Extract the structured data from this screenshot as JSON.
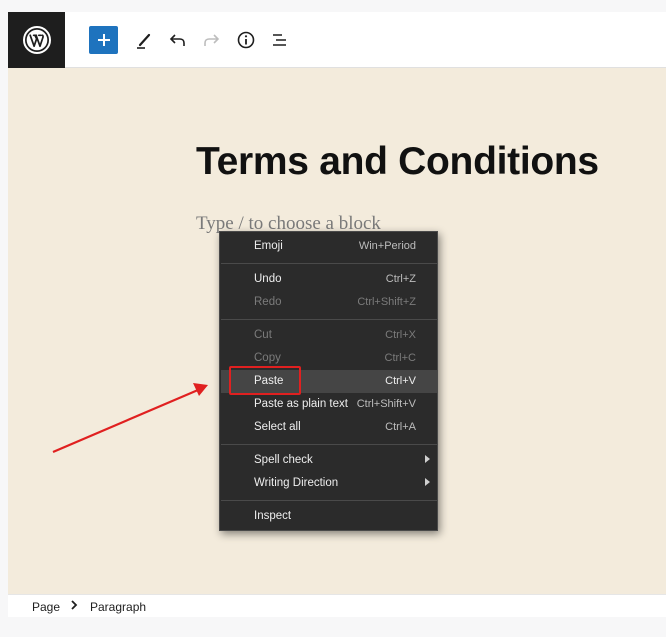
{
  "toolbar": {
    "logo_icon": "wordpress-logo",
    "add_icon": "plus-icon",
    "edit_icon": "pencil-icon",
    "undo_icon": "undo-icon",
    "redo_icon": "redo-icon",
    "info_icon": "info-icon",
    "list_view_icon": "list-view-icon"
  },
  "editor": {
    "title": "Terms and Conditions",
    "placeholder": "Type / to choose a block"
  },
  "context_menu": {
    "items": [
      {
        "label": "Emoji",
        "shortcut": "Win+Period",
        "enabled": true
      },
      {
        "label": "Undo",
        "shortcut": "Ctrl+Z",
        "enabled": true
      },
      {
        "label": "Redo",
        "shortcut": "Ctrl+Shift+Z",
        "enabled": false
      },
      {
        "label": "Cut",
        "shortcut": "Ctrl+X",
        "enabled": false
      },
      {
        "label": "Copy",
        "shortcut": "Ctrl+C",
        "enabled": false
      },
      {
        "label": "Paste",
        "shortcut": "Ctrl+V",
        "enabled": true,
        "highlighted": true
      },
      {
        "label": "Paste as plain text",
        "shortcut": "Ctrl+Shift+V",
        "enabled": true
      },
      {
        "label": "Select all",
        "shortcut": "Ctrl+A",
        "enabled": true
      },
      {
        "label": "Spell check",
        "submenu": true,
        "enabled": true
      },
      {
        "label": "Writing Direction",
        "submenu": true,
        "enabled": true
      },
      {
        "label": "Inspect",
        "enabled": true
      }
    ]
  },
  "breadcrumb": {
    "items": [
      "Page",
      "Paragraph"
    ],
    "separator_icon": "chevron-right-icon"
  },
  "colors": {
    "canvas_bg": "#f3ebdc",
    "accent_blue": "#1e73be",
    "menu_bg": "#2b2b2b",
    "annotation_red": "#e02020"
  }
}
